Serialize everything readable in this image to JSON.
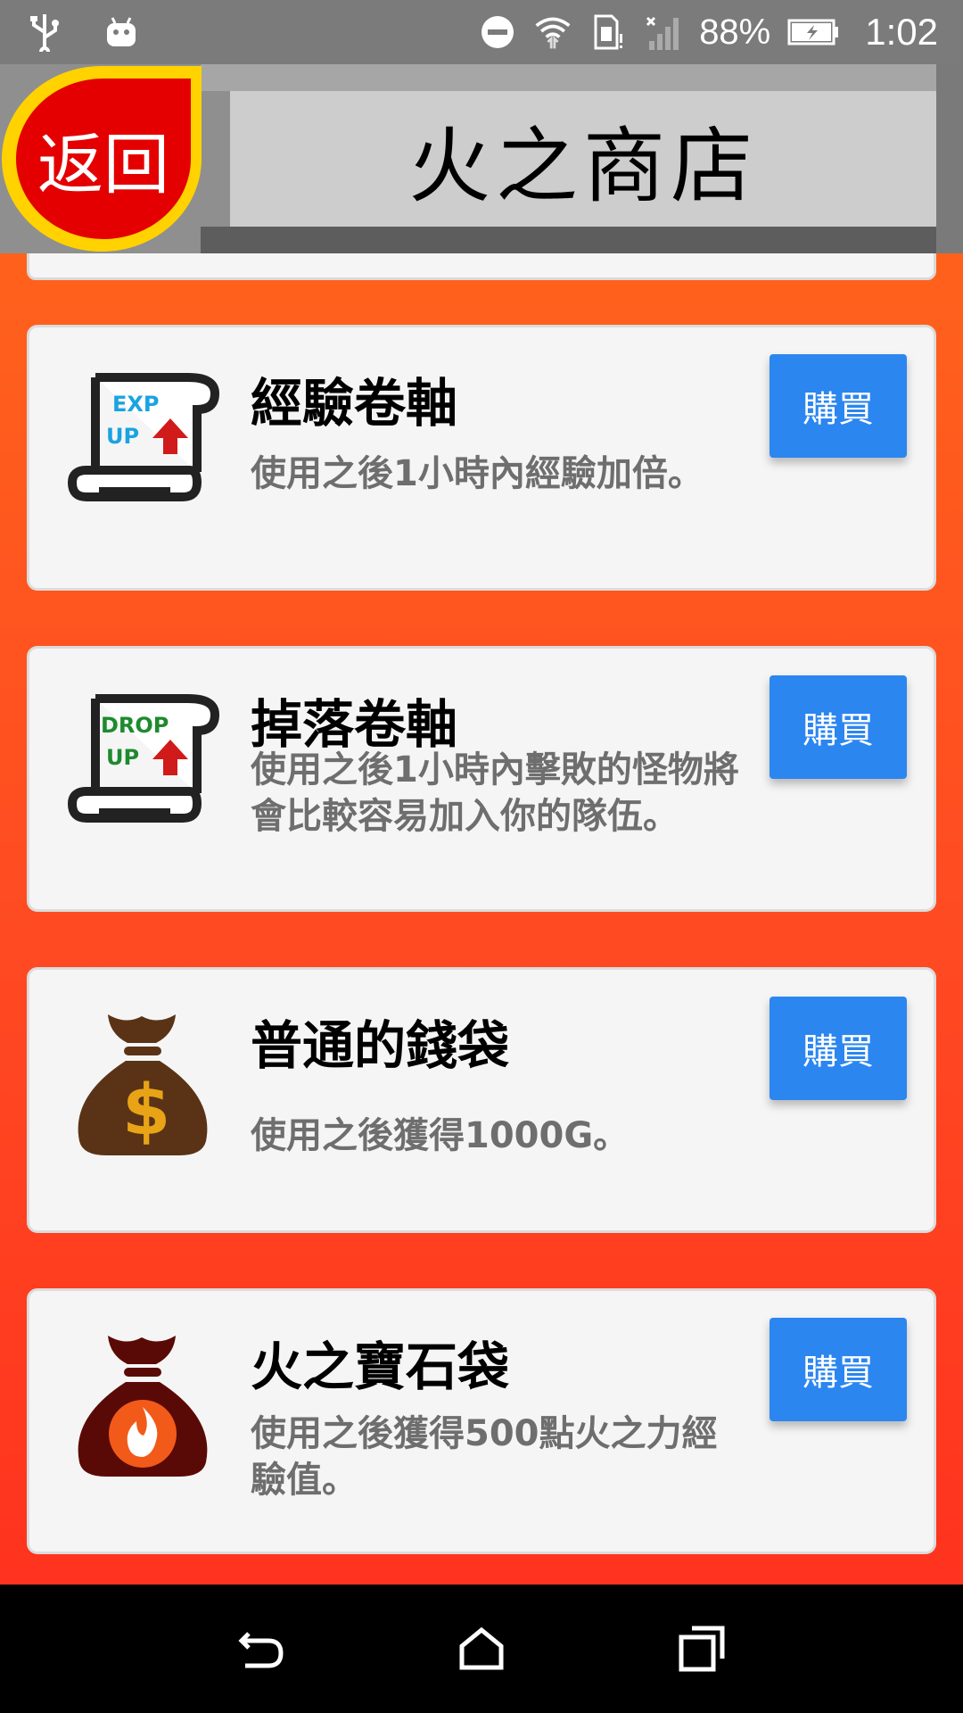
{
  "status_bar": {
    "battery_percent": "88%",
    "time": "1:02",
    "icons": [
      "usb-icon",
      "android-icon",
      "do-not-disturb-icon",
      "wifi-icon",
      "sim-icon",
      "signal-icon",
      "battery-charging-icon"
    ]
  },
  "header": {
    "back_label": "返回",
    "title": "火之商店"
  },
  "items": [
    {
      "name": "經驗卷軸",
      "description": "使用之後1小時內經驗加倍。",
      "buy_label": "購買",
      "icon": "exp-scroll-icon",
      "icon_text_line1": "EXP",
      "icon_text_line2": "UP"
    },
    {
      "name": "掉落卷軸",
      "description": "使用之後1小時內擊敗的怪物將會比較容易加入你的隊伍。",
      "buy_label": "購買",
      "icon": "drop-scroll-icon",
      "icon_text_line1": "DROP",
      "icon_text_line2": "UP"
    },
    {
      "name": "普通的錢袋",
      "description": "使用之後獲得1000G。",
      "buy_label": "購買",
      "icon": "money-bag-icon",
      "icon_text_line1": "$"
    },
    {
      "name": "火之寶石袋",
      "description": "使用之後獲得500點火之力經驗值。",
      "buy_label": "購買",
      "icon": "fire-gem-bag-icon"
    }
  ],
  "nav_bar": {
    "icons": [
      "back-nav-icon",
      "home-nav-icon",
      "recents-nav-icon"
    ]
  },
  "colors": {
    "background_top": "#ff6a1a",
    "background_bottom": "#ff2e1e",
    "buy_button": "#2b86f0",
    "back_button_fill": "#e40000",
    "back_button_ring": "#ffd200"
  }
}
